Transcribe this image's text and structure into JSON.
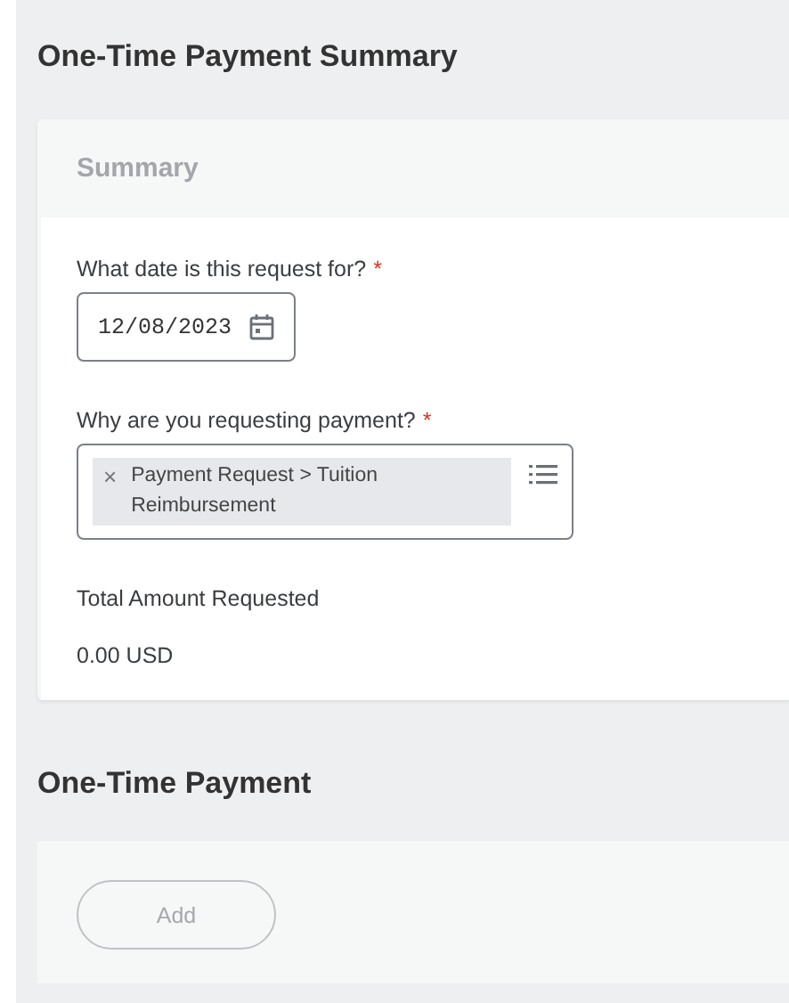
{
  "title": "One-Time Payment Summary",
  "summary": {
    "header": "Summary",
    "fields": [
      {
        "kind": "date",
        "label": "What date is this request for?",
        "required": true,
        "required_mark": "*",
        "value": "12/08/2023"
      },
      {
        "kind": "multiselect",
        "label": "Why are you requesting payment?",
        "required": true,
        "required_mark": "*",
        "chips": [
          {
            "remove": "×",
            "text": "Payment Request > Tuition Reimbursement"
          }
        ]
      },
      {
        "kind": "readonly",
        "label": "Total Amount Requested",
        "value": "0.00 USD"
      }
    ]
  },
  "payment": {
    "title": "One-Time Payment",
    "add_button": {
      "label": "Add",
      "disabled": true
    }
  }
}
